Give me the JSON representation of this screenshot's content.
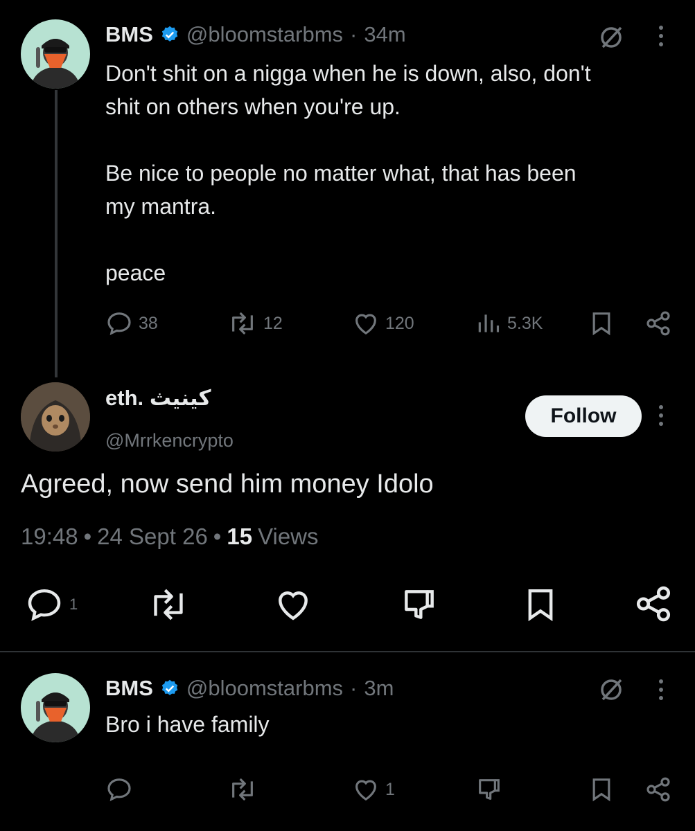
{
  "tweet1": {
    "name": "BMS",
    "handle": "@bloomstarbms",
    "dot": "·",
    "time": "34m",
    "lines": [
      "Don't shit on a nigga when he is down, also, don't",
      "shit on others when you're up.",
      "Be nice to people no matter what, that has been",
      "my mantra.",
      "peace"
    ],
    "replies": "38",
    "retweets": "12",
    "likes": "120",
    "views": "5.3K"
  },
  "reply": {
    "name": "eth. كينيث",
    "handle": "@Mrrkencrypto",
    "follow_label": "Follow",
    "text": "Agreed, now send him money Idolo",
    "time": "19:48",
    "dot": "•",
    "date": "24 Sept 26",
    "views_count": "15",
    "views_label": "Views",
    "replies": "1"
  },
  "tweet2": {
    "name": "BMS",
    "handle": "@bloomstarbms",
    "dot": "·",
    "time": "3m",
    "text": "Bro i have family",
    "likes": "1"
  },
  "colors": {
    "verified": "#1d9bf0",
    "background": "#000000",
    "text": "#e7e9ea",
    "muted": "#71767b",
    "avatar_bg": "#b7e2d2",
    "mask": "#e8622c"
  }
}
